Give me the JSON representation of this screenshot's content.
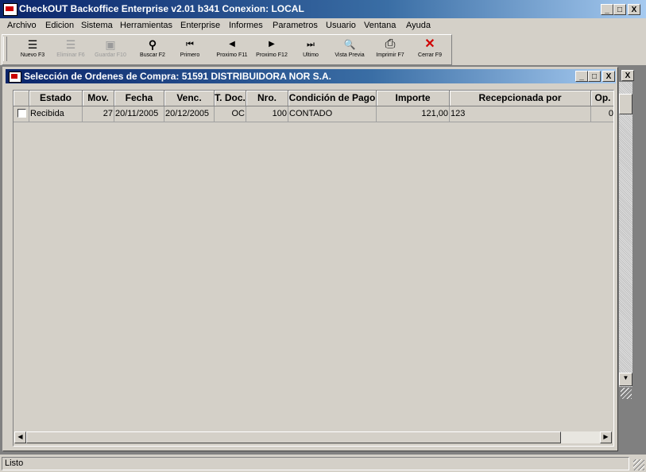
{
  "window": {
    "title": "CheckOUT Backoffice Enterprise v2.01 b341 Conexion: LOCAL",
    "minimize": "_",
    "maximize": "□",
    "close": "X"
  },
  "menu": [
    "Archivo",
    "Edicion",
    "Sistema",
    "Herramientas",
    "Enterprise",
    "Informes",
    "Parametros",
    "Usuario",
    "Ventana",
    "Ayuda"
  ],
  "toolbar": [
    {
      "label": "Nuevo F3",
      "icon": "new-list-icon",
      "glyph": "☰",
      "enabled": true
    },
    {
      "label": "Eliminar F6",
      "icon": "delete-list-icon",
      "glyph": "☰",
      "enabled": false
    },
    {
      "label": "Guardar F10",
      "icon": "save-disk-icon",
      "glyph": "▣",
      "enabled": false
    },
    {
      "label": "Buscar F2",
      "icon": "binoculars-icon",
      "glyph": "⚲",
      "enabled": true
    },
    {
      "label": "Primero",
      "icon": "first-record-icon",
      "glyph": "⏮",
      "enabled": true
    },
    {
      "label": "Proximo F11",
      "icon": "previous-record-icon",
      "glyph": "◀",
      "enabled": true
    },
    {
      "label": "Proximo F12",
      "icon": "next-record-icon",
      "glyph": "▶",
      "enabled": true
    },
    {
      "label": "Ultimo",
      "icon": "last-record-icon",
      "glyph": "⏭",
      "enabled": true
    },
    {
      "label": "Vista Previa",
      "icon": "print-preview-icon",
      "glyph": "🔍",
      "enabled": true
    },
    {
      "label": "Imprimir F7",
      "icon": "printer-icon",
      "glyph": "⎙",
      "enabled": true
    },
    {
      "label": "Cerrar F9",
      "icon": "close-red-x-icon",
      "glyph": "✕",
      "enabled": true
    }
  ],
  "child_window": {
    "title": "Selección de Ordenes de Compra: 51591 DISTRIBUIDORA NOR S.A.",
    "minimize": "_",
    "maximize": "□",
    "close": "X"
  },
  "grid": {
    "columns": [
      "",
      "Estado",
      "Mov.",
      "Fecha",
      "Venc.",
      "T. Doc.",
      "Nro.",
      "Condición de Pago",
      "Importe",
      "Recepcionada por",
      "Op."
    ],
    "rows": [
      {
        "checked": false,
        "estado": "Recibida",
        "mov": "27",
        "fecha": "20/11/2005",
        "venc": "20/12/2005",
        "tdoc": "OC",
        "nro": "100",
        "condicion": "CONTADO",
        "importe": "121,00",
        "recepcionada": "123",
        "op": "0"
      }
    ]
  },
  "mdi_close": "X",
  "status": {
    "text": "Listo"
  },
  "colors": {
    "titlebar_start": "#0a246a",
    "titlebar_end": "#a6caf0",
    "face": "#d4d0c8",
    "close_icon": "#d00000"
  }
}
